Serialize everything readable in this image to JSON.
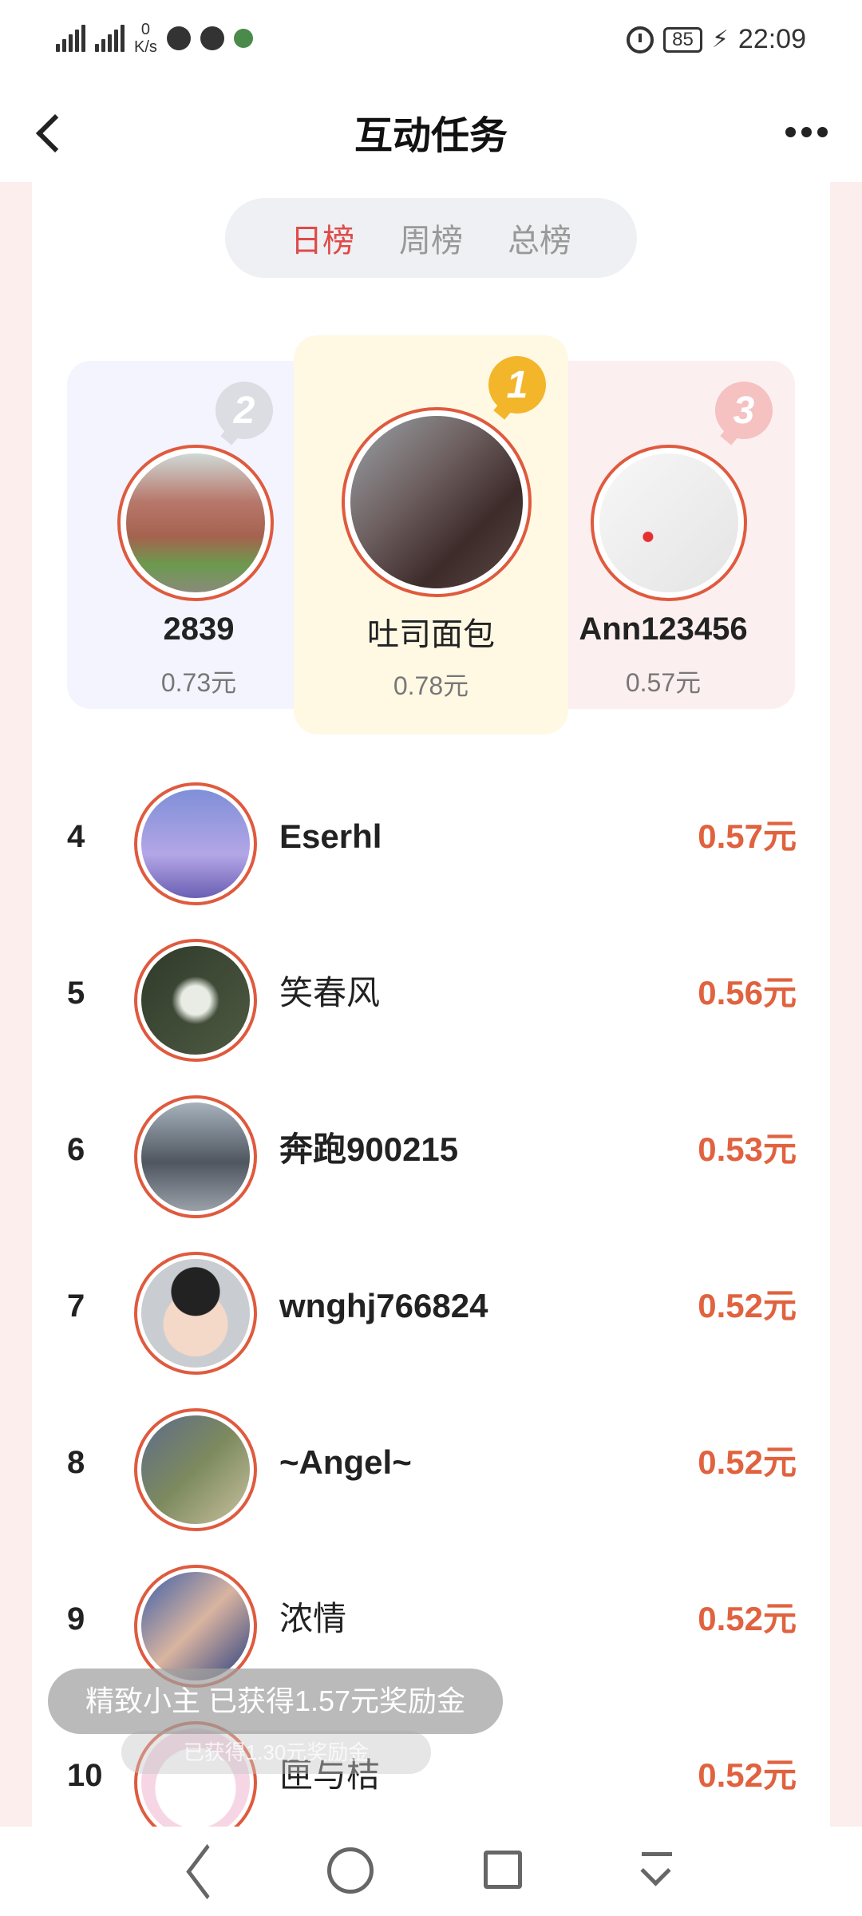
{
  "status_bar": {
    "net_speed_value": "0",
    "net_speed_unit": "K/s",
    "battery": "85",
    "time": "22:09"
  },
  "header": {
    "title": "互动任务"
  },
  "tabs": [
    {
      "label": "日榜",
      "active": true
    },
    {
      "label": "周榜",
      "active": false
    },
    {
      "label": "总榜",
      "active": false
    }
  ],
  "podium": {
    "first": {
      "rank": "1",
      "name": "吐司面包",
      "amount": "0.78元"
    },
    "second": {
      "rank": "2",
      "name": "2839",
      "amount": "0.73元"
    },
    "third": {
      "rank": "3",
      "name": "Ann123456",
      "amount": "0.57元"
    }
  },
  "list": [
    {
      "rank": "4",
      "name": "Eserhl",
      "amount": "0.57元"
    },
    {
      "rank": "5",
      "name": "笑春风",
      "amount": "0.56元"
    },
    {
      "rank": "6",
      "name": "奔跑900215",
      "amount": "0.53元"
    },
    {
      "rank": "7",
      "name": "wnghj766824",
      "amount": "0.52元"
    },
    {
      "rank": "8",
      "name": "~Angel~",
      "amount": "0.52元"
    },
    {
      "rank": "9",
      "name": "浓情",
      "amount": "0.52元"
    },
    {
      "rank": "10",
      "name": "匣与桔",
      "amount": "0.52元"
    }
  ],
  "toast": {
    "text": "精致小主   已获得1.57元奖励金"
  },
  "toast_faint": {
    "text": "已获得1.30元奖励金"
  },
  "colors": {
    "accent_tab": "#e04a4a",
    "amount": "#e0623f",
    "avatar_ring": "#df5a3e"
  }
}
